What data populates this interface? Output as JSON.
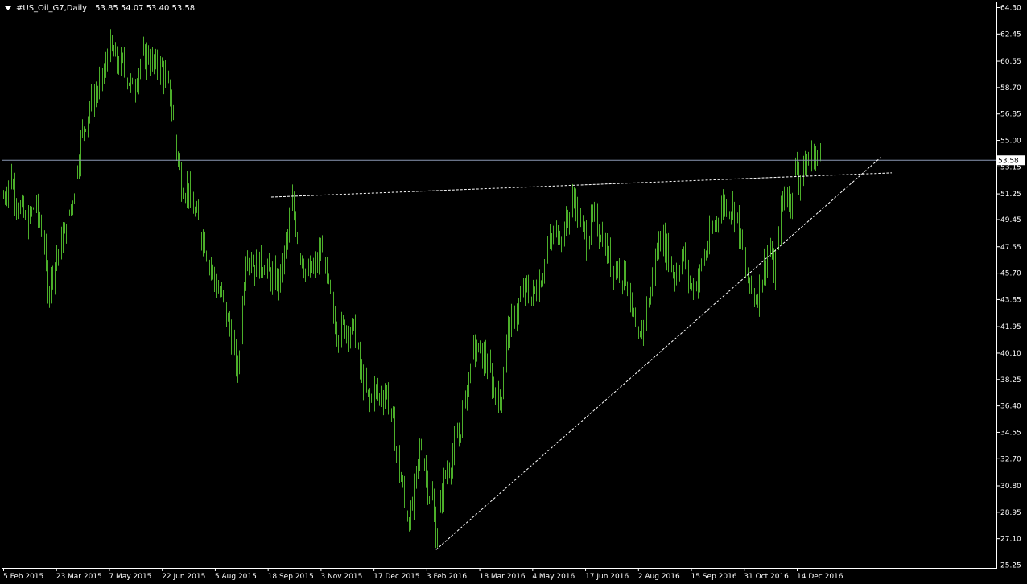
{
  "header": {
    "symbol": "#US_Oil_G7,Daily",
    "ohlc": "53.85 54.07 53.40 53.58"
  },
  "colors": {
    "background": "#000000",
    "candle": "#4caf2a",
    "axis": "#ffffff",
    "price_line": "#8a97b4",
    "trendline": "#ffffff"
  },
  "chart_data": {
    "type": "ohlc-bar",
    "x_tick_labels": [
      "5 Feb 2015",
      "23 Mar 2015",
      "7 May 2015",
      "22 Jun 2015",
      "5 Aug 2015",
      "18 Sep 2015",
      "3 Nov 2015",
      "17 Dec 2015",
      "3 Feb 2016",
      "18 Mar 2016",
      "4 May 2016",
      "17 Jun 2016",
      "2 Aug 2016",
      "15 Sep 2016",
      "31 Oct 2016",
      "14 Dec 2016"
    ],
    "y_tick_labels": [
      "64.30",
      "62.45",
      "60.55",
      "58.70",
      "56.85",
      "55.00",
      "53.15",
      "51.25",
      "49.45",
      "47.55",
      "45.70",
      "43.85",
      "41.95",
      "40.10",
      "38.25",
      "36.40",
      "34.55",
      "32.70",
      "30.80",
      "28.95",
      "27.10",
      "25.25"
    ],
    "ylim": [
      25.25,
      64.3
    ],
    "current_price": 53.58,
    "current_price_label": "53.58",
    "price_path": [
      [
        "5 Feb 2015",
        51.0
      ],
      [
        "11 Feb 2015",
        52.5
      ],
      [
        "18 Feb 2015",
        50.5
      ],
      [
        "25 Feb 2015",
        49.0
      ],
      [
        "4 Mar 2015",
        50.5
      ],
      [
        "11 Mar 2015",
        48.5
      ],
      [
        "16 Mar 2015",
        44.5
      ],
      [
        "23 Mar 2015",
        47.0
      ],
      [
        "30 Mar 2015",
        48.5
      ],
      [
        "6 Apr 2015",
        51.0
      ],
      [
        "13 Apr 2015",
        55.0
      ],
      [
        "20 Apr 2015",
        57.5
      ],
      [
        "27 Apr 2015",
        58.5
      ],
      [
        "4 May 2015",
        60.0
      ],
      [
        "7 May 2015",
        61.5
      ],
      [
        "13 May 2015",
        60.5
      ],
      [
        "20 May 2015",
        60.0
      ],
      [
        "27 May 2015",
        58.5
      ],
      [
        "3 Jun 2015",
        60.5
      ],
      [
        "10 Jun 2015",
        61.0
      ],
      [
        "15 Jun 2015",
        60.0
      ],
      [
        "22 Jun 2015",
        60.0
      ],
      [
        "29 Jun 2015",
        58.0
      ],
      [
        "3 Jul 2015",
        55.0
      ],
      [
        "8 Jul 2015",
        52.0
      ],
      [
        "14 Jul 2015",
        51.5
      ],
      [
        "20 Jul 2015",
        49.5
      ],
      [
        "27 Jul 2015",
        48.0
      ],
      [
        "5 Aug 2015",
        45.0
      ],
      [
        "12 Aug 2015",
        43.5
      ],
      [
        "19 Aug 2015",
        41.0
      ],
      [
        "24 Aug 2015",
        38.5
      ],
      [
        "31 Aug 2015",
        47.5
      ],
      [
        "7 Sep 2015",
        46.0
      ],
      [
        "14 Sep 2015",
        46.5
      ],
      [
        "18 Sep 2015",
        45.5
      ],
      [
        "23 Sep 2015",
        45.5
      ],
      [
        "28 Sep 2015",
        45.0
      ],
      [
        "5 Oct 2015",
        48.5
      ],
      [
        "9 Oct 2015",
        50.5
      ],
      [
        "15 Oct 2015",
        47.5
      ],
      [
        "22 Oct 2015",
        45.5
      ],
      [
        "29 Oct 2015",
        46.0
      ],
      [
        "3 Nov 2015",
        47.5
      ],
      [
        "10 Nov 2015",
        44.0
      ],
      [
        "17 Nov 2015",
        41.5
      ],
      [
        "24 Nov 2015",
        42.0
      ],
      [
        "1 Dec 2015",
        41.5
      ],
      [
        "7 Dec 2015",
        38.0
      ],
      [
        "14 Dec 2015",
        36.5
      ],
      [
        "17 Dec 2015",
        37.5
      ],
      [
        "22 Dec 2015",
        37.0
      ],
      [
        "28 Dec 2015",
        37.5
      ],
      [
        "5 Jan 2016",
        34.0
      ],
      [
        "11 Jan 2016",
        31.0
      ],
      [
        "15 Jan 2016",
        29.0
      ],
      [
        "20 Jan 2016",
        28.5
      ],
      [
        "26 Jan 2016",
        32.5
      ],
      [
        "29 Jan 2016",
        34.0
      ],
      [
        "3 Feb 2016",
        31.0
      ],
      [
        "8 Feb 2016",
        29.5
      ],
      [
        "11 Feb 2016",
        27.0
      ],
      [
        "17 Feb 2016",
        31.0
      ],
      [
        "24 Feb 2016",
        33.0
      ],
      [
        "1 Mar 2016",
        34.5
      ],
      [
        "8 Mar 2016",
        38.0
      ],
      [
        "14 Mar 2016",
        40.5
      ],
      [
        "18 Mar 2016",
        40.0
      ],
      [
        "24 Mar 2016",
        39.5
      ],
      [
        "1 Apr 2016",
        37.0
      ],
      [
        "5 Apr 2016",
        36.5
      ],
      [
        "12 Apr 2016",
        41.5
      ],
      [
        "19 Apr 2016",
        43.0
      ],
      [
        "26 Apr 2016",
        44.5
      ],
      [
        "4 May 2016",
        44.0
      ],
      [
        "10 May 2016",
        45.0
      ],
      [
        "17 May 2016",
        47.5
      ],
      [
        "24 May 2016",
        48.5
      ],
      [
        "1 Jun 2016",
        49.0
      ],
      [
        "8 Jun 2016",
        51.0
      ],
      [
        "13 Jun 2016",
        49.0
      ],
      [
        "17 Jun 2016",
        48.0
      ],
      [
        "24 Jun 2016",
        49.5
      ],
      [
        "1 Jul 2016",
        48.5
      ],
      [
        "8 Jul 2016",
        46.5
      ],
      [
        "15 Jul 2016",
        46.0
      ],
      [
        "22 Jul 2016",
        45.5
      ],
      [
        "28 Jul 2016",
        42.5
      ],
      [
        "2 Aug 2016",
        40.5
      ],
      [
        "5 Aug 2016",
        41.5
      ],
      [
        "12 Aug 2016",
        44.5
      ],
      [
        "19 Aug 2016",
        48.0
      ],
      [
        "25 Aug 2016",
        47.5
      ],
      [
        "1 Sep 2016",
        45.5
      ],
      [
        "8 Sep 2016",
        47.0
      ],
      [
        "15 Sep 2016",
        44.5
      ],
      [
        "22 Sep 2016",
        45.5
      ],
      [
        "29 Sep 2016",
        47.5
      ],
      [
        "5 Oct 2016",
        49.0
      ],
      [
        "12 Oct 2016",
        50.5
      ],
      [
        "19 Oct 2016",
        50.5
      ],
      [
        "25 Oct 2016",
        49.5
      ],
      [
        "31 Oct 2016",
        46.5
      ],
      [
        "4 Nov 2016",
        44.5
      ],
      [
        "10 Nov 2016",
        44.0
      ],
      [
        "15 Nov 2016",
        45.5
      ],
      [
        "21 Nov 2016",
        47.5
      ],
      [
        "25 Nov 2016",
        45.5
      ],
      [
        "1 Dec 2016",
        50.5
      ],
      [
        "5 Dec 2016",
        51.5
      ],
      [
        "8 Dec 2016",
        50.5
      ],
      [
        "12 Dec 2016",
        53.0
      ],
      [
        "14 Dec 2016",
        53.0
      ],
      [
        "16 Dec 2016",
        52.0
      ],
      [
        "20 Dec 2016",
        53.0
      ],
      [
        "23 Dec 2016",
        53.5
      ],
      [
        "28 Dec 2016",
        54.0
      ],
      [
        "3 Jan 2017",
        53.58
      ]
    ],
    "lines": [
      {
        "name": "resistance",
        "style": "dotted",
        "from": [
          "21 Sep 2015",
          51.0
        ],
        "to": [
          "3 Mar 2017",
          52.7
        ]
      },
      {
        "name": "support",
        "style": "dotted",
        "from": [
          "11 Feb 2016",
          26.3
        ],
        "to": [
          "22 Feb 2017",
          53.8
        ]
      }
    ]
  }
}
